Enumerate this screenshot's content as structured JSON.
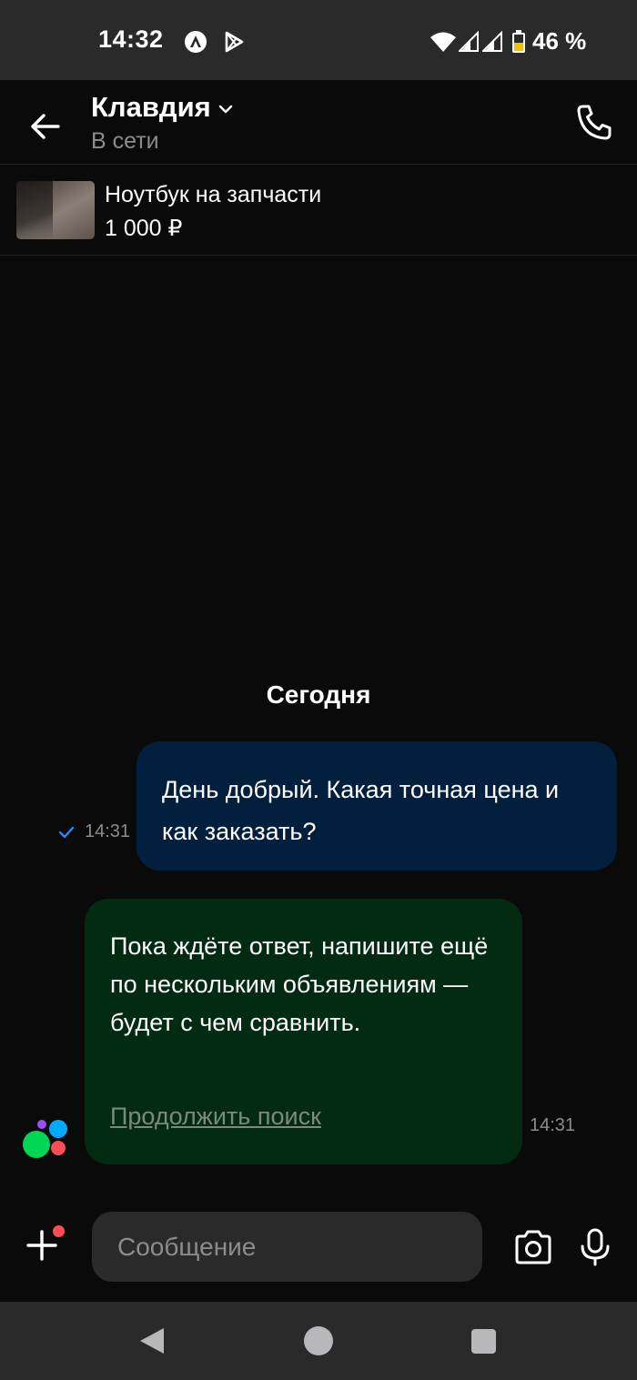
{
  "status_bar": {
    "time": "14:32",
    "battery_percent": "46 %",
    "icons": [
      "app-a-icon",
      "play-store-icon",
      "wifi-icon",
      "signal-icon",
      "signal-icon",
      "battery-icon"
    ]
  },
  "header": {
    "contact_name": "Клавдия",
    "contact_status": "В сети",
    "icons": [
      "back-arrow-icon",
      "chevron-down-icon",
      "phone-icon"
    ]
  },
  "listing": {
    "title": "Ноутбук на запчасти",
    "price": "1 000 ₽"
  },
  "chat": {
    "date_separator": "Сегодня",
    "messages": [
      {
        "direction": "outgoing",
        "text": "День добрый. Какая точная цена и как заказать?",
        "time": "14:31",
        "status": "sent"
      },
      {
        "direction": "incoming",
        "text": "Пока ждёте ответ, напишите ещё по нескольким объявлениям — будет с чем сравнить.",
        "link": "Продолжить поиск",
        "time": "14:31"
      }
    ]
  },
  "composer": {
    "placeholder": "Сообщение",
    "value": "",
    "icons": [
      "plus-icon",
      "camera-icon",
      "microphone-icon"
    ]
  },
  "colors": {
    "background": "#0a0a0b",
    "bar": "#2a2a2b",
    "outgoing_bubble": "#02203d",
    "incoming_bubble": "#022b12",
    "muted_text": "#8c8c90",
    "tick": "#2f8fff",
    "avatar_dots": [
      "#9b4dff",
      "#00aaff",
      "#00d654",
      "#ff4d55"
    ]
  }
}
